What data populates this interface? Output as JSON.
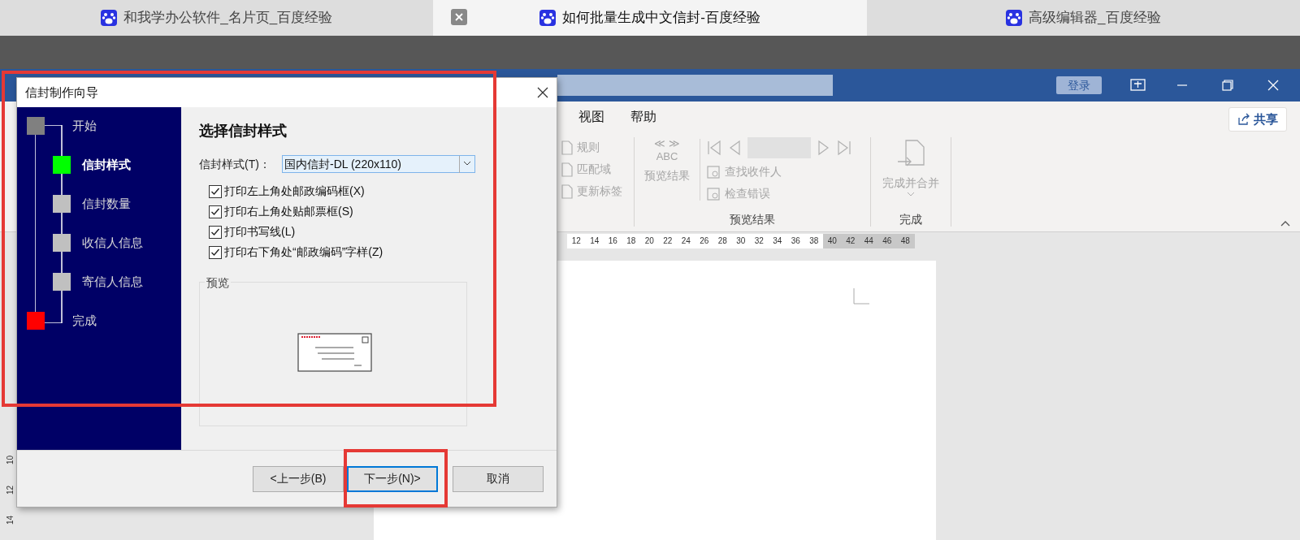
{
  "browser_tabs": [
    {
      "label": "和我学办公软件_名片页_百度经验",
      "selected": false
    },
    {
      "label": "如何批量生成中文信封-百度经验",
      "selected": true
    },
    {
      "label": "高级编辑器_百度经验",
      "selected": false
    }
  ],
  "word": {
    "login_button": "登录",
    "ribbon_tabs": [
      "视图",
      "帮助"
    ],
    "share_button": "共享",
    "field_commands": [
      "规则",
      "匹配域",
      "更新标签"
    ],
    "preview_button": {
      "symbols": "≪ ≫",
      "abc": "ABC",
      "label": "预览结果"
    },
    "preview_commands": [
      "查找收件人",
      "检查错误"
    ],
    "finish_button": "完成并合并",
    "group_labels": [
      "预览结果",
      "完成"
    ],
    "ruler": [
      {
        "label": "12",
        "margin": false
      },
      {
        "label": "14",
        "margin": false
      },
      {
        "label": "16",
        "margin": false
      },
      {
        "label": "18",
        "margin": false
      },
      {
        "label": "20",
        "margin": false
      },
      {
        "label": "22",
        "margin": false
      },
      {
        "label": "24",
        "margin": false
      },
      {
        "label": "26",
        "margin": false
      },
      {
        "label": "28",
        "margin": false
      },
      {
        "label": "30",
        "margin": false
      },
      {
        "label": "32",
        "margin": false
      },
      {
        "label": "34",
        "margin": false
      },
      {
        "label": "36",
        "margin": false
      },
      {
        "label": "38",
        "margin": false
      },
      {
        "label": "40",
        "margin": true
      },
      {
        "label": "42",
        "margin": true
      },
      {
        "label": "44",
        "margin": true
      },
      {
        "label": "46",
        "margin": true
      },
      {
        "label": "48",
        "margin": true
      }
    ],
    "vertical_ruler": [
      "10",
      "12",
      "14"
    ]
  },
  "dialog": {
    "title": "信封制作向导",
    "steps": [
      {
        "label": "开始",
        "selected": false,
        "color": "#808080",
        "kind": "end"
      },
      {
        "label": "信封样式",
        "selected": true,
        "color": "#00ff00",
        "kind": "step"
      },
      {
        "label": "信封数量",
        "selected": false,
        "color": "#c0c0c0",
        "kind": "step"
      },
      {
        "label": "收信人信息",
        "selected": false,
        "color": "#c0c0c0",
        "kind": "step"
      },
      {
        "label": "寄信人信息",
        "selected": false,
        "color": "#c0c0c0",
        "kind": "step"
      },
      {
        "label": "完成",
        "selected": false,
        "color": "#ff0000",
        "kind": "end"
      }
    ],
    "heading": "选择信封样式",
    "style_label": "信封样式(T)：",
    "style_value": "国内信封-DL (220x110)",
    "options": [
      {
        "label": "打印左上角处邮政编码框(X)",
        "checked": true
      },
      {
        "label": "打印右上角处贴邮票框(S)",
        "checked": true
      },
      {
        "label": "打印书写线(L)",
        "checked": true
      },
      {
        "label": "打印右下角处“邮政编码”字样(Z)",
        "checked": true
      }
    ],
    "preview_label": "预览",
    "buttons": [
      {
        "label": "<上一步(B)",
        "selected": false
      },
      {
        "label": "下一步(N)>",
        "selected": true
      },
      {
        "label": "取消",
        "selected": false
      }
    ]
  }
}
